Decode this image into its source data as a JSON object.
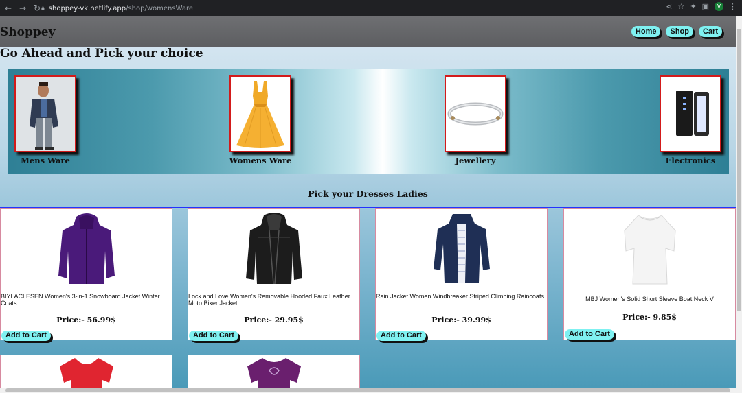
{
  "browser": {
    "url_host": "shoppey-vk.netlify.app",
    "url_path": "/shop/womensWare",
    "avatar_letter": "V"
  },
  "header": {
    "brand": "Shoppey",
    "nav": [
      "Home",
      "Shop",
      "Cart"
    ]
  },
  "page": {
    "title": "Go Ahead and Pick your choice",
    "section_title": "Pick your Dresses Ladies"
  },
  "categories": [
    {
      "label": "Mens Ware",
      "icon": "man-suit-image"
    },
    {
      "label": "Womens Ware",
      "icon": "yellow-dress-image"
    },
    {
      "label": "Jewellery",
      "icon": "bracelet-image"
    },
    {
      "label": "Electronics",
      "icon": "power-bank-image"
    }
  ],
  "products": [
    {
      "name": "BIYLACLESEN Women's 3-in-1 Snowboard Jacket Winter Coats",
      "price": "Price:- 56.99$",
      "button": "Add to Cart",
      "image": "purple-jacket-image"
    },
    {
      "name": "Lock and Love Women's Removable Hooded Faux Leather Moto Biker Jacket",
      "price": "Price:- 29.95$",
      "button": "Add to Cart",
      "image": "black-leather-jacket-image"
    },
    {
      "name": "Rain Jacket Women Windbreaker Striped Climbing Raincoats",
      "price": "Price:- 39.99$",
      "button": "Add to Cart",
      "image": "navy-raincoat-image"
    },
    {
      "name": "MBJ Women's Solid Short Sleeve Boat Neck V",
      "price": "Price:- 9.85$",
      "button": "Add to Cart",
      "image": "white-tshirt-image"
    },
    {
      "image": "red-tshirt-image"
    },
    {
      "image": "purple-tshirt-image"
    }
  ],
  "colors": {
    "accent_button": "#7ff1f1",
    "header_bg": "#5d5e61",
    "card_border": "#d78aa0",
    "category_border": "#d31b1b"
  }
}
